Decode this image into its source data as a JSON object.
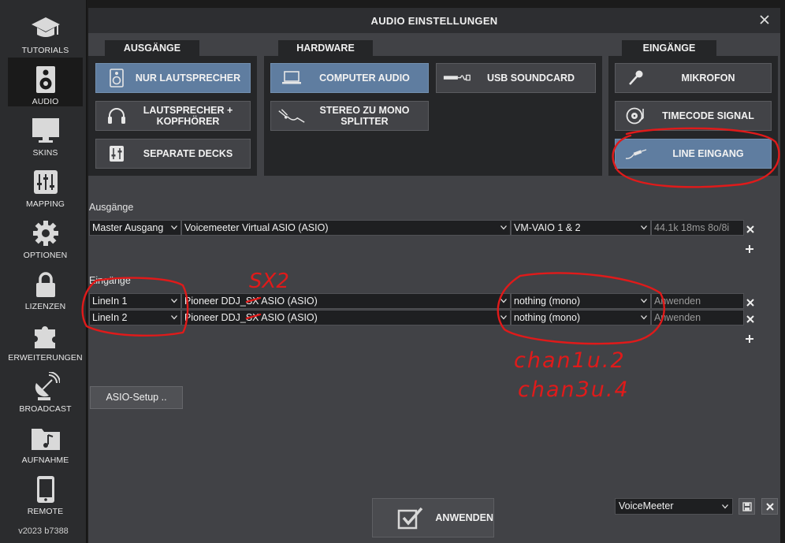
{
  "sidebar": {
    "items": [
      {
        "label": "TUTORIALS",
        "icon": "graduation-cap-icon"
      },
      {
        "label": "AUDIO",
        "icon": "speaker-icon"
      },
      {
        "label": "SKINS",
        "icon": "monitor-icon"
      },
      {
        "label": "MAPPING",
        "icon": "sliders-icon"
      },
      {
        "label": "OPTIONEN",
        "icon": "gear-icon"
      },
      {
        "label": "LIZENZEN",
        "icon": "lock-icon"
      },
      {
        "label": "ERWEITERUNGEN",
        "icon": "puzzle-icon"
      },
      {
        "label": "BROADCAST",
        "icon": "satellite-dish-icon"
      },
      {
        "label": "AUFNAHME",
        "icon": "music-folder-icon"
      },
      {
        "label": "REMOTE",
        "icon": "smartphone-icon"
      }
    ],
    "active": "AUDIO",
    "version": "v2023 b7388"
  },
  "window": {
    "title": "AUDIO EINSTELLUNGEN"
  },
  "outputs_group": {
    "tab": "AUSGÄNGE",
    "buttons": [
      {
        "label": "NUR LAUTSPRECHER",
        "icon": "speaker-icon",
        "selected": true
      },
      {
        "label": "LAUTSPRECHER + KOPFHÖRER",
        "icon": "headphones-icon",
        "selected": false
      },
      {
        "label": "SEPARATE DECKS",
        "icon": "mixer-icon",
        "selected": false
      }
    ]
  },
  "hardware_group": {
    "tab": "HARDWARE",
    "buttons": [
      {
        "label": "COMPUTER AUDIO",
        "icon": "laptop-icon",
        "selected": true
      },
      {
        "label": "USB SOUNDCARD",
        "icon": "usb-cable-icon",
        "selected": false
      },
      {
        "label": "STEREO ZU MONO SPLITTER",
        "icon": "splitter-cable-icon",
        "selected": false
      }
    ]
  },
  "inputs_group": {
    "tab": "EINGÄNGE",
    "buttons": [
      {
        "label": "MIKROFON",
        "icon": "microphone-icon",
        "selected": false
      },
      {
        "label": "TIMECODE SIGNAL",
        "icon": "vinyl-icon",
        "selected": false
      },
      {
        "label": "LINE EINGANG",
        "icon": "line-cable-icon",
        "selected": true
      }
    ]
  },
  "outputs_section": {
    "label": "Ausgänge",
    "rows": [
      {
        "channel": "Master Ausgang",
        "device": "Voicemeeter Virtual ASIO (ASIO)",
        "port": "VM-VAIO 1 & 2",
        "info": "44.1k 18ms 8o/8i"
      }
    ]
  },
  "inputs_section": {
    "label": "Eingänge",
    "rows": [
      {
        "channel": "LineIn 1",
        "device": "Pioneer DDJ_SX ASIO (ASIO)",
        "port": "nothing (mono)",
        "info": "Anwenden"
      },
      {
        "channel": "LineIn 2",
        "device": "Pioneer DDJ_SX ASIO (ASIO)",
        "port": "nothing (mono)",
        "info": "Anwenden"
      }
    ]
  },
  "asio_setup_label": "ASIO-Setup ..",
  "apply_label": "ANWENDEN",
  "preset": {
    "value": "VoiceMeeter"
  },
  "handwritten": {
    "sx2": "SX2",
    "line1": "chan1u.2",
    "line2": "chan3u.4"
  },
  "colors": {
    "accent_selected": "#5f7da0",
    "annotation_red": "#e01a1a"
  }
}
